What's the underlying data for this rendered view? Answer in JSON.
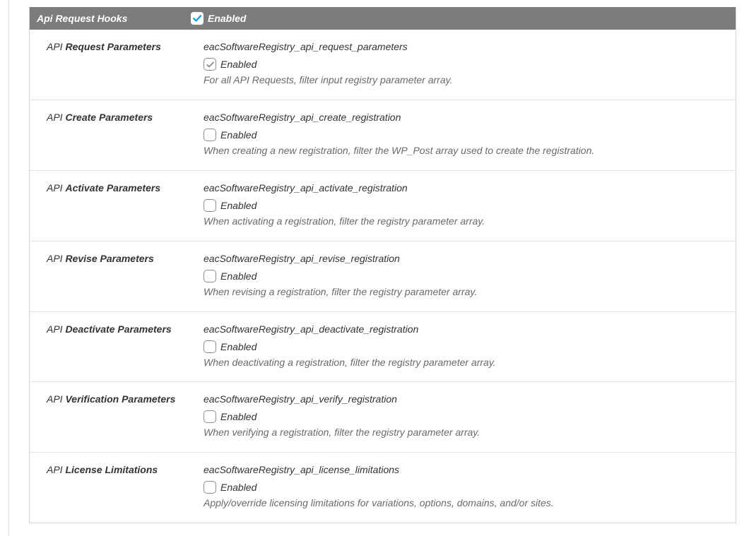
{
  "header": {
    "title": "Api Request Hooks",
    "enabled_label": "Enabled",
    "checked": true
  },
  "rows": [
    {
      "label_prefix": "API ",
      "label_main": "Request Parameters",
      "hook": "eacSoftwareRegistry_api_request_parameters",
      "enabled_label": "Enabled",
      "checked": true,
      "desc": "For all API Requests, filter input registry parameter array."
    },
    {
      "label_prefix": "API ",
      "label_main": "Create Parameters",
      "hook": "eacSoftwareRegistry_api_create_registration",
      "enabled_label": "Enabled",
      "checked": false,
      "desc": "When creating a new registration, filter the WP_Post array used to create the registration."
    },
    {
      "label_prefix": "API ",
      "label_main": "Activate Parameters",
      "hook": "eacSoftwareRegistry_api_activate_registration",
      "enabled_label": "Enabled",
      "checked": false,
      "desc": "When activating a registration, filter the registry parameter array."
    },
    {
      "label_prefix": "API ",
      "label_main": "Revise Parameters",
      "hook": "eacSoftwareRegistry_api_revise_registration",
      "enabled_label": "Enabled",
      "checked": false,
      "desc": "When revising a registration, filter the registry parameter array."
    },
    {
      "label_prefix": "API ",
      "label_main": "Deactivate Parameters",
      "hook": "eacSoftwareRegistry_api_deactivate_registration",
      "enabled_label": "Enabled",
      "checked": false,
      "desc": "When deactivating a registration, filter the registry parameter array."
    },
    {
      "label_prefix": "API ",
      "label_main": "Verification Parameters",
      "hook": "eacSoftwareRegistry_api_verify_registration",
      "enabled_label": "Enabled",
      "checked": false,
      "desc": "When verifying a registration, filter the registry parameter array."
    },
    {
      "label_prefix": "API ",
      "label_main": "License Limitations",
      "hook": "eacSoftwareRegistry_api_license_limitations",
      "enabled_label": "Enabled",
      "checked": false,
      "desc": "Apply/override licensing limitations for variations, options, domains, and/or sites."
    }
  ]
}
